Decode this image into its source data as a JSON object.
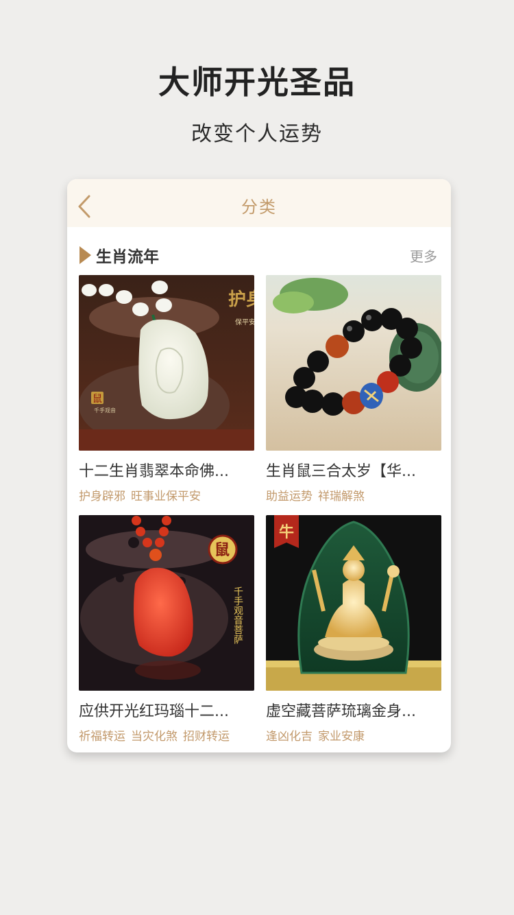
{
  "hero": {
    "title": "大师开光圣品",
    "subtitle": "改变个人运势"
  },
  "header": {
    "title": "分类",
    "back_icon": "chevron-left-icon"
  },
  "section": {
    "title": "生肖流年",
    "more": "更多"
  },
  "products": [
    {
      "name": "十二生肖翡翠本命佛...",
      "tags": [
        "护身辟邪",
        "旺事业保平安"
      ],
      "badge": "护身",
      "badge_small": "保平安",
      "side_label": "鼠",
      "side_caption": "千手观音"
    },
    {
      "name": "生肖鼠三合太岁【华...",
      "tags": [
        "助益运势",
        "祥瑞解煞"
      ]
    },
    {
      "name": "应供开光红玛瑙十二...",
      "tags": [
        "祈福转运",
        "当灾化煞",
        "招财转运"
      ],
      "badge": "鼠",
      "side_caption": "千手观音菩萨"
    },
    {
      "name": "虚空藏菩萨琉璃金身...",
      "tags": [
        "逢凶化吉",
        "家业安康"
      ],
      "badge": "牛"
    }
  ],
  "colors": {
    "background": "#efeeec",
    "header_bg": "#fbf6ee",
    "accent": "#c29a6a",
    "marker": "#b88a52"
  }
}
